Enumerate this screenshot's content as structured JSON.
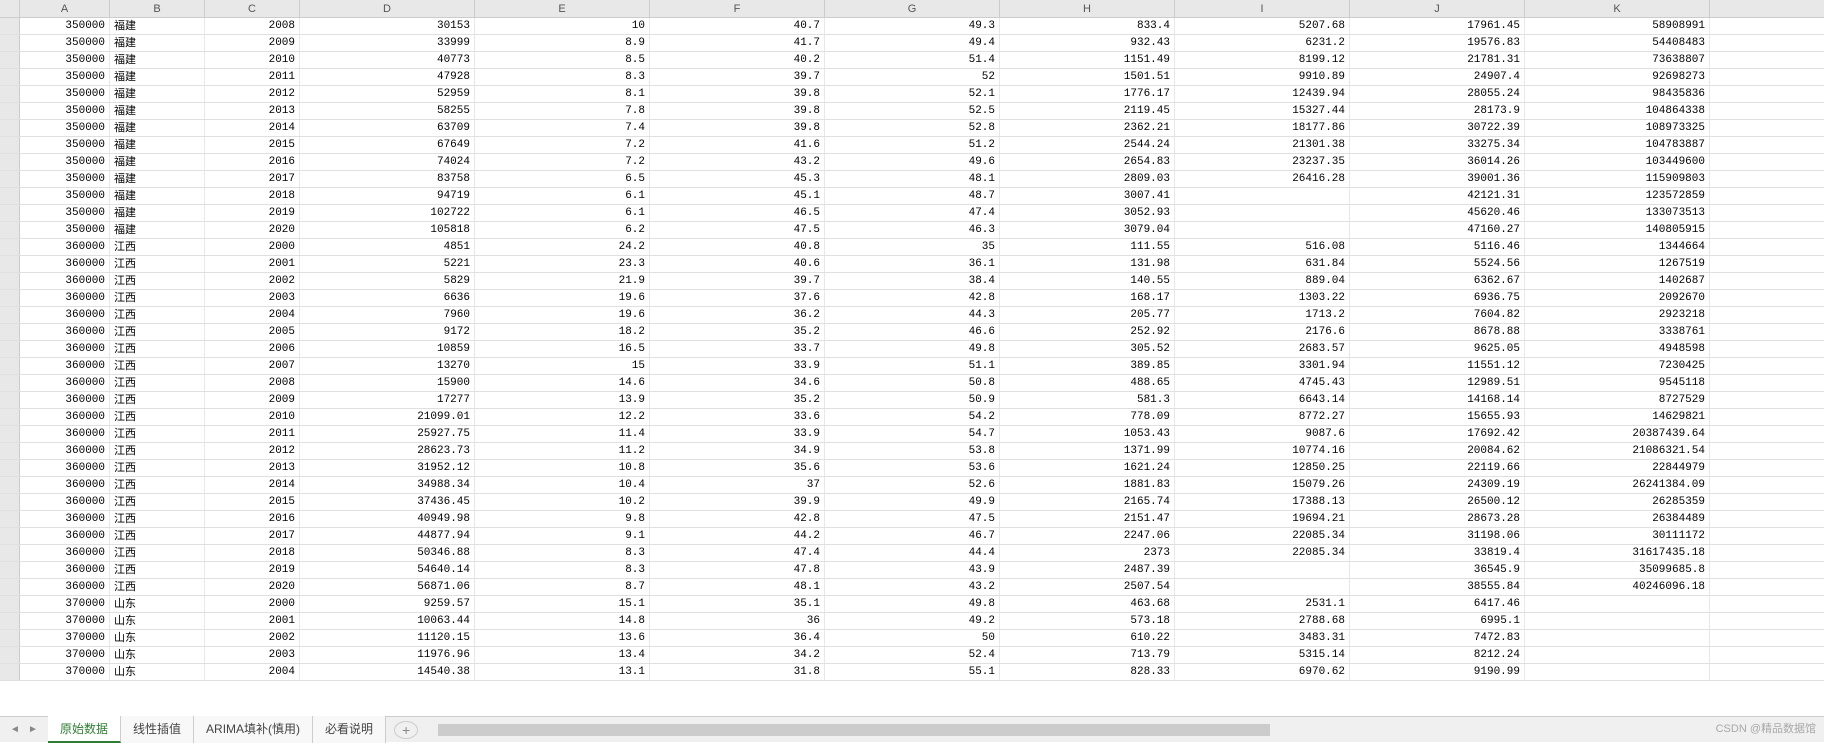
{
  "columns": [
    "A",
    "B",
    "C",
    "D",
    "E",
    "F",
    "G",
    "H",
    "I",
    "J",
    "K"
  ],
  "tabs": [
    {
      "label": "原始数据",
      "active": true
    },
    {
      "label": "线性插值",
      "active": false
    },
    {
      "label": "ARIMA填补(慎用)",
      "active": false
    },
    {
      "label": "必看说明",
      "active": false
    }
  ],
  "watermark": "CSDN @精品数据馆",
  "rows": [
    {
      "A": "350000",
      "B": "福建",
      "C": "2008",
      "D": "30153",
      "E": "10",
      "F": "40.7",
      "G": "49.3",
      "H": "833.4",
      "I": "5207.68",
      "J": "17961.45",
      "K": "58908991"
    },
    {
      "A": "350000",
      "B": "福建",
      "C": "2009",
      "D": "33999",
      "E": "8.9",
      "F": "41.7",
      "G": "49.4",
      "H": "932.43",
      "I": "6231.2",
      "J": "19576.83",
      "K": "54408483"
    },
    {
      "A": "350000",
      "B": "福建",
      "C": "2010",
      "D": "40773",
      "E": "8.5",
      "F": "40.2",
      "G": "51.4",
      "H": "1151.49",
      "I": "8199.12",
      "J": "21781.31",
      "K": "73638807"
    },
    {
      "A": "350000",
      "B": "福建",
      "C": "2011",
      "D": "47928",
      "E": "8.3",
      "F": "39.7",
      "G": "52",
      "H": "1501.51",
      "I": "9910.89",
      "J": "24907.4",
      "K": "92698273"
    },
    {
      "A": "350000",
      "B": "福建",
      "C": "2012",
      "D": "52959",
      "E": "8.1",
      "F": "39.8",
      "G": "52.1",
      "H": "1776.17",
      "I": "12439.94",
      "J": "28055.24",
      "K": "98435836"
    },
    {
      "A": "350000",
      "B": "福建",
      "C": "2013",
      "D": "58255",
      "E": "7.8",
      "F": "39.8",
      "G": "52.5",
      "H": "2119.45",
      "I": "15327.44",
      "J": "28173.9",
      "K": "104864338"
    },
    {
      "A": "350000",
      "B": "福建",
      "C": "2014",
      "D": "63709",
      "E": "7.4",
      "F": "39.8",
      "G": "52.8",
      "H": "2362.21",
      "I": "18177.86",
      "J": "30722.39",
      "K": "108973325"
    },
    {
      "A": "350000",
      "B": "福建",
      "C": "2015",
      "D": "67649",
      "E": "7.2",
      "F": "41.6",
      "G": "51.2",
      "H": "2544.24",
      "I": "21301.38",
      "J": "33275.34",
      "K": "104783887"
    },
    {
      "A": "350000",
      "B": "福建",
      "C": "2016",
      "D": "74024",
      "E": "7.2",
      "F": "43.2",
      "G": "49.6",
      "H": "2654.83",
      "I": "23237.35",
      "J": "36014.26",
      "K": "103449600"
    },
    {
      "A": "350000",
      "B": "福建",
      "C": "2017",
      "D": "83758",
      "E": "6.5",
      "F": "45.3",
      "G": "48.1",
      "H": "2809.03",
      "I": "26416.28",
      "J": "39001.36",
      "K": "115909803"
    },
    {
      "A": "350000",
      "B": "福建",
      "C": "2018",
      "D": "94719",
      "E": "6.1",
      "F": "45.1",
      "G": "48.7",
      "H": "3007.41",
      "I": "",
      "J": "42121.31",
      "K": "123572859"
    },
    {
      "A": "350000",
      "B": "福建",
      "C": "2019",
      "D": "102722",
      "E": "6.1",
      "F": "46.5",
      "G": "47.4",
      "H": "3052.93",
      "I": "",
      "J": "45620.46",
      "K": "133073513"
    },
    {
      "A": "350000",
      "B": "福建",
      "C": "2020",
      "D": "105818",
      "E": "6.2",
      "F": "47.5",
      "G": "46.3",
      "H": "3079.04",
      "I": "",
      "J": "47160.27",
      "K": "140805915"
    },
    {
      "A": "360000",
      "B": "江西",
      "C": "2000",
      "D": "4851",
      "E": "24.2",
      "F": "40.8",
      "G": "35",
      "H": "111.55",
      "I": "516.08",
      "J": "5116.46",
      "K": "1344664"
    },
    {
      "A": "360000",
      "B": "江西",
      "C": "2001",
      "D": "5221",
      "E": "23.3",
      "F": "40.6",
      "G": "36.1",
      "H": "131.98",
      "I": "631.84",
      "J": "5524.56",
      "K": "1267519"
    },
    {
      "A": "360000",
      "B": "江西",
      "C": "2002",
      "D": "5829",
      "E": "21.9",
      "F": "39.7",
      "G": "38.4",
      "H": "140.55",
      "I": "889.04",
      "J": "6362.67",
      "K": "1402687"
    },
    {
      "A": "360000",
      "B": "江西",
      "C": "2003",
      "D": "6636",
      "E": "19.6",
      "F": "37.6",
      "G": "42.8",
      "H": "168.17",
      "I": "1303.22",
      "J": "6936.75",
      "K": "2092670"
    },
    {
      "A": "360000",
      "B": "江西",
      "C": "2004",
      "D": "7960",
      "E": "19.6",
      "F": "36.2",
      "G": "44.3",
      "H": "205.77",
      "I": "1713.2",
      "J": "7604.82",
      "K": "2923218"
    },
    {
      "A": "360000",
      "B": "江西",
      "C": "2005",
      "D": "9172",
      "E": "18.2",
      "F": "35.2",
      "G": "46.6",
      "H": "252.92",
      "I": "2176.6",
      "J": "8678.88",
      "K": "3338761"
    },
    {
      "A": "360000",
      "B": "江西",
      "C": "2006",
      "D": "10859",
      "E": "16.5",
      "F": "33.7",
      "G": "49.8",
      "H": "305.52",
      "I": "2683.57",
      "J": "9625.05",
      "K": "4948598"
    },
    {
      "A": "360000",
      "B": "江西",
      "C": "2007",
      "D": "13270",
      "E": "15",
      "F": "33.9",
      "G": "51.1",
      "H": "389.85",
      "I": "3301.94",
      "J": "11551.12",
      "K": "7230425"
    },
    {
      "A": "360000",
      "B": "江西",
      "C": "2008",
      "D": "15900",
      "E": "14.6",
      "F": "34.6",
      "G": "50.8",
      "H": "488.65",
      "I": "4745.43",
      "J": "12989.51",
      "K": "9545118"
    },
    {
      "A": "360000",
      "B": "江西",
      "C": "2009",
      "D": "17277",
      "E": "13.9",
      "F": "35.2",
      "G": "50.9",
      "H": "581.3",
      "I": "6643.14",
      "J": "14168.14",
      "K": "8727529"
    },
    {
      "A": "360000",
      "B": "江西",
      "C": "2010",
      "D": "21099.01",
      "E": "12.2",
      "F": "33.6",
      "G": "54.2",
      "H": "778.09",
      "I": "8772.27",
      "J": "15655.93",
      "K": "14629821"
    },
    {
      "A": "360000",
      "B": "江西",
      "C": "2011",
      "D": "25927.75",
      "E": "11.4",
      "F": "33.9",
      "G": "54.7",
      "H": "1053.43",
      "I": "9087.6",
      "J": "17692.42",
      "K": "20387439.64"
    },
    {
      "A": "360000",
      "B": "江西",
      "C": "2012",
      "D": "28623.73",
      "E": "11.2",
      "F": "34.9",
      "G": "53.8",
      "H": "1371.99",
      "I": "10774.16",
      "J": "20084.62",
      "K": "21086321.54"
    },
    {
      "A": "360000",
      "B": "江西",
      "C": "2013",
      "D": "31952.12",
      "E": "10.8",
      "F": "35.6",
      "G": "53.6",
      "H": "1621.24",
      "I": "12850.25",
      "J": "22119.66",
      "K": "22844979"
    },
    {
      "A": "360000",
      "B": "江西",
      "C": "2014",
      "D": "34988.34",
      "E": "10.4",
      "F": "37",
      "G": "52.6",
      "H": "1881.83",
      "I": "15079.26",
      "J": "24309.19",
      "K": "26241384.09"
    },
    {
      "A": "360000",
      "B": "江西",
      "C": "2015",
      "D": "37436.45",
      "E": "10.2",
      "F": "39.9",
      "G": "49.9",
      "H": "2165.74",
      "I": "17388.13",
      "J": "26500.12",
      "K": "26285359"
    },
    {
      "A": "360000",
      "B": "江西",
      "C": "2016",
      "D": "40949.98",
      "E": "9.8",
      "F": "42.8",
      "G": "47.5",
      "H": "2151.47",
      "I": "19694.21",
      "J": "28673.28",
      "K": "26384489"
    },
    {
      "A": "360000",
      "B": "江西",
      "C": "2017",
      "D": "44877.94",
      "E": "9.1",
      "F": "44.2",
      "G": "46.7",
      "H": "2247.06",
      "I": "22085.34",
      "J": "31198.06",
      "K": "30111172"
    },
    {
      "A": "360000",
      "B": "江西",
      "C": "2018",
      "D": "50346.88",
      "E": "8.3",
      "F": "47.4",
      "G": "44.4",
      "H": "2373",
      "I": "22085.34",
      "J": "33819.4",
      "K": "31617435.18"
    },
    {
      "A": "360000",
      "B": "江西",
      "C": "2019",
      "D": "54640.14",
      "E": "8.3",
      "F": "47.8",
      "G": "43.9",
      "H": "2487.39",
      "I": "",
      "J": "36545.9",
      "K": "35099685.8"
    },
    {
      "A": "360000",
      "B": "江西",
      "C": "2020",
      "D": "56871.06",
      "E": "8.7",
      "F": "48.1",
      "G": "43.2",
      "H": "2507.54",
      "I": "",
      "J": "38555.84",
      "K": "40246096.18"
    },
    {
      "A": "370000",
      "B": "山东",
      "C": "2000",
      "D": "9259.57",
      "E": "15.1",
      "F": "35.1",
      "G": "49.8",
      "H": "463.68",
      "I": "2531.1",
      "J": "6417.46",
      "K": ""
    },
    {
      "A": "370000",
      "B": "山东",
      "C": "2001",
      "D": "10063.44",
      "E": "14.8",
      "F": "36",
      "G": "49.2",
      "H": "573.18",
      "I": "2788.68",
      "J": "6995.1",
      "K": ""
    },
    {
      "A": "370000",
      "B": "山东",
      "C": "2002",
      "D": "11120.15",
      "E": "13.6",
      "F": "36.4",
      "G": "50",
      "H": "610.22",
      "I": "3483.31",
      "J": "7472.83",
      "K": ""
    },
    {
      "A": "370000",
      "B": "山东",
      "C": "2003",
      "D": "11976.96",
      "E": "13.4",
      "F": "34.2",
      "G": "52.4",
      "H": "713.79",
      "I": "5315.14",
      "J": "8212.24",
      "K": ""
    },
    {
      "A": "370000",
      "B": "山东",
      "C": "2004",
      "D": "14540.38",
      "E": "13.1",
      "F": "31.8",
      "G": "55.1",
      "H": "828.33",
      "I": "6970.62",
      "J": "9190.99",
      "K": ""
    }
  ]
}
